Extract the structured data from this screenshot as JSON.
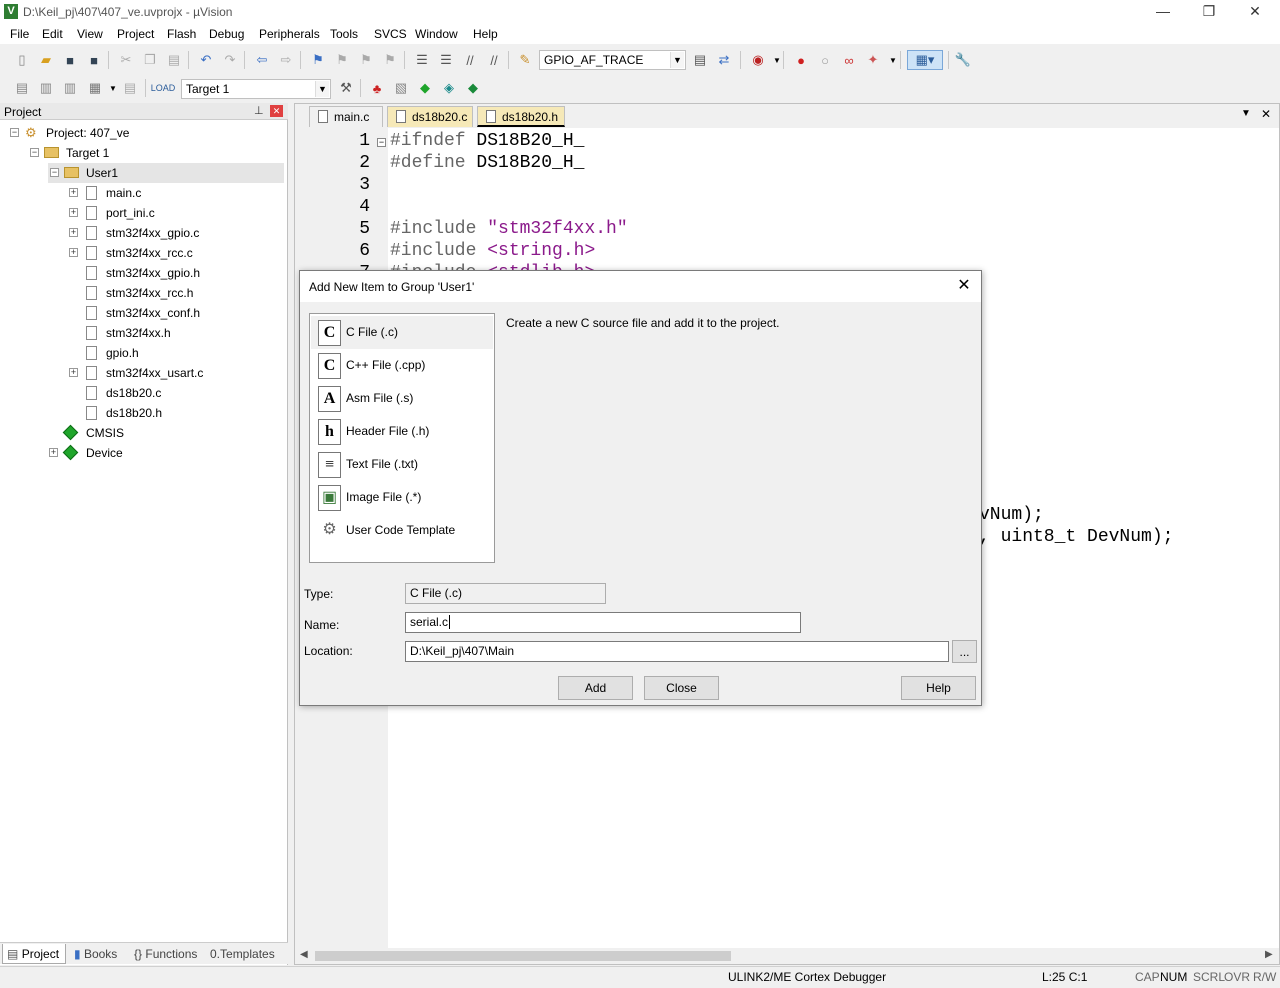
{
  "window": {
    "title": "D:\\Keil_pj\\407\\407_ve.uvprojx - µVision",
    "minimize": "—",
    "restore": "❐",
    "close": "✕"
  },
  "menu": [
    "File",
    "Edit",
    "View",
    "Project",
    "Flash",
    "Debug",
    "Peripherals",
    "Tools",
    "SVCS",
    "Window",
    "Help"
  ],
  "toolbar1": {
    "search_combo_value": "GPIO_AF_TRACE"
  },
  "toolbar2": {
    "target_combo_value": "Target 1"
  },
  "project_panel": {
    "title": "Project",
    "tree": {
      "project": "Project: 407_ve",
      "target": "Target 1",
      "group": "User1",
      "files": [
        "main.c",
        "port_ini.c",
        "stm32f4xx_gpio.c",
        "stm32f4xx_rcc.c",
        "stm32f4xx_gpio.h",
        "stm32f4xx_rcc.h",
        "stm32f4xx_conf.h",
        "stm32f4xx.h",
        "gpio.h",
        "stm32f4xx_usart.c",
        "ds18b20.c",
        "ds18b20.h"
      ],
      "cmsis": "CMSIS",
      "device": "Device"
    },
    "bottom_tabs": [
      "Project",
      "Books",
      "Functions",
      "Templates"
    ]
  },
  "editor": {
    "tabs": [
      "main.c",
      "ds18b20.c",
      "ds18b20.h"
    ],
    "active_tab": "ds18b20.h",
    "line_numbers": [
      "1",
      "2",
      "3",
      "4",
      "5",
      "6",
      "7"
    ],
    "lines": [
      {
        "kw": "#ifndef",
        "rest": " DS18B20_H_"
      },
      {
        "kw": "#define",
        "rest": " DS18B20_H_"
      },
      {
        "kw": "",
        "rest": ""
      },
      {
        "kw": "",
        "rest": ""
      },
      {
        "kw": "#include",
        "rest": " \"stm32f4xx.h\""
      },
      {
        "kw": "#include",
        "rest": " <string.h>"
      },
      {
        "kw": "#include",
        "rest": " <stdlib.h>"
      }
    ],
    "visible_fragment_1": "vNum);",
    "visible_fragment_2": ", uint8_t DevNum);"
  },
  "status": {
    "debugger": "ULINK2/ME Cortex Debugger",
    "position": "L:25 C:1",
    "cap": "CAP",
    "num": "NUM",
    "scrl": "SCRL",
    "ovr": "OVR",
    "rw": "R/W"
  },
  "dialog": {
    "title": "Add New Item to Group 'User1'",
    "close": "✕",
    "types": [
      {
        "label": "C File (.c)",
        "icon": "C"
      },
      {
        "label": "C++ File (.cpp)",
        "icon": "C"
      },
      {
        "label": "Asm File (.s)",
        "icon": "A"
      },
      {
        "label": "Header File (.h)",
        "icon": "h"
      },
      {
        "label": "Text File (.txt)",
        "icon": "≡"
      },
      {
        "label": "Image File (.*)",
        "icon": "▣"
      },
      {
        "label": "User Code Template",
        "icon": "⚙"
      }
    ],
    "description": "Create a new C source file and add it to the project.",
    "type_label": "Type:",
    "type_value": "C File (.c)",
    "name_label": "Name:",
    "name_value": "serial.c",
    "location_label": "Location:",
    "location_value": "D:\\Keil_pj\\407\\Main",
    "browse": "...",
    "add_button": "Add",
    "close_button": "Close",
    "help_button": "Help"
  }
}
